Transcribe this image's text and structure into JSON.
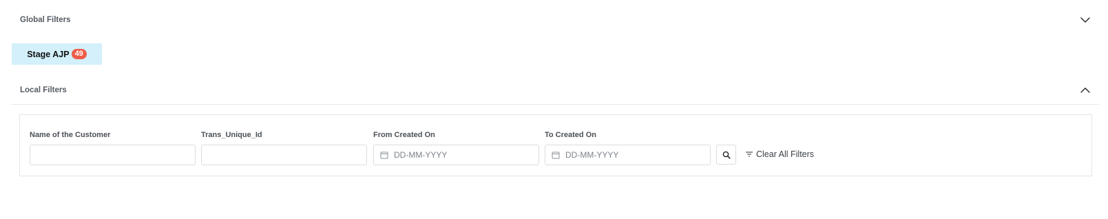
{
  "global_filters": {
    "title": "Global Filters",
    "toggle_icon": "chevron-down-icon"
  },
  "stage_chip": {
    "label": "Stage AJP",
    "count": "49",
    "background": "#d3f0fb",
    "badge_color": "#ee5d48"
  },
  "local_filters": {
    "title": "Local Filters",
    "toggle_icon": "chevron-up-icon",
    "fields": [
      {
        "label": "Name of the Customer",
        "value": "",
        "placeholder": ""
      },
      {
        "label": "Trans_Unique_Id",
        "value": "",
        "placeholder": ""
      },
      {
        "label": "From Created On",
        "value": "",
        "placeholder": "DD-MM-YYYY",
        "icon": "calendar-icon"
      },
      {
        "label": "To Created On",
        "value": "",
        "placeholder": "DD-MM-YYYY",
        "icon": "calendar-icon"
      }
    ],
    "search_icon": "search-icon",
    "clear_all": {
      "label": "Clear All Filters",
      "icon": "filter-icon"
    }
  }
}
